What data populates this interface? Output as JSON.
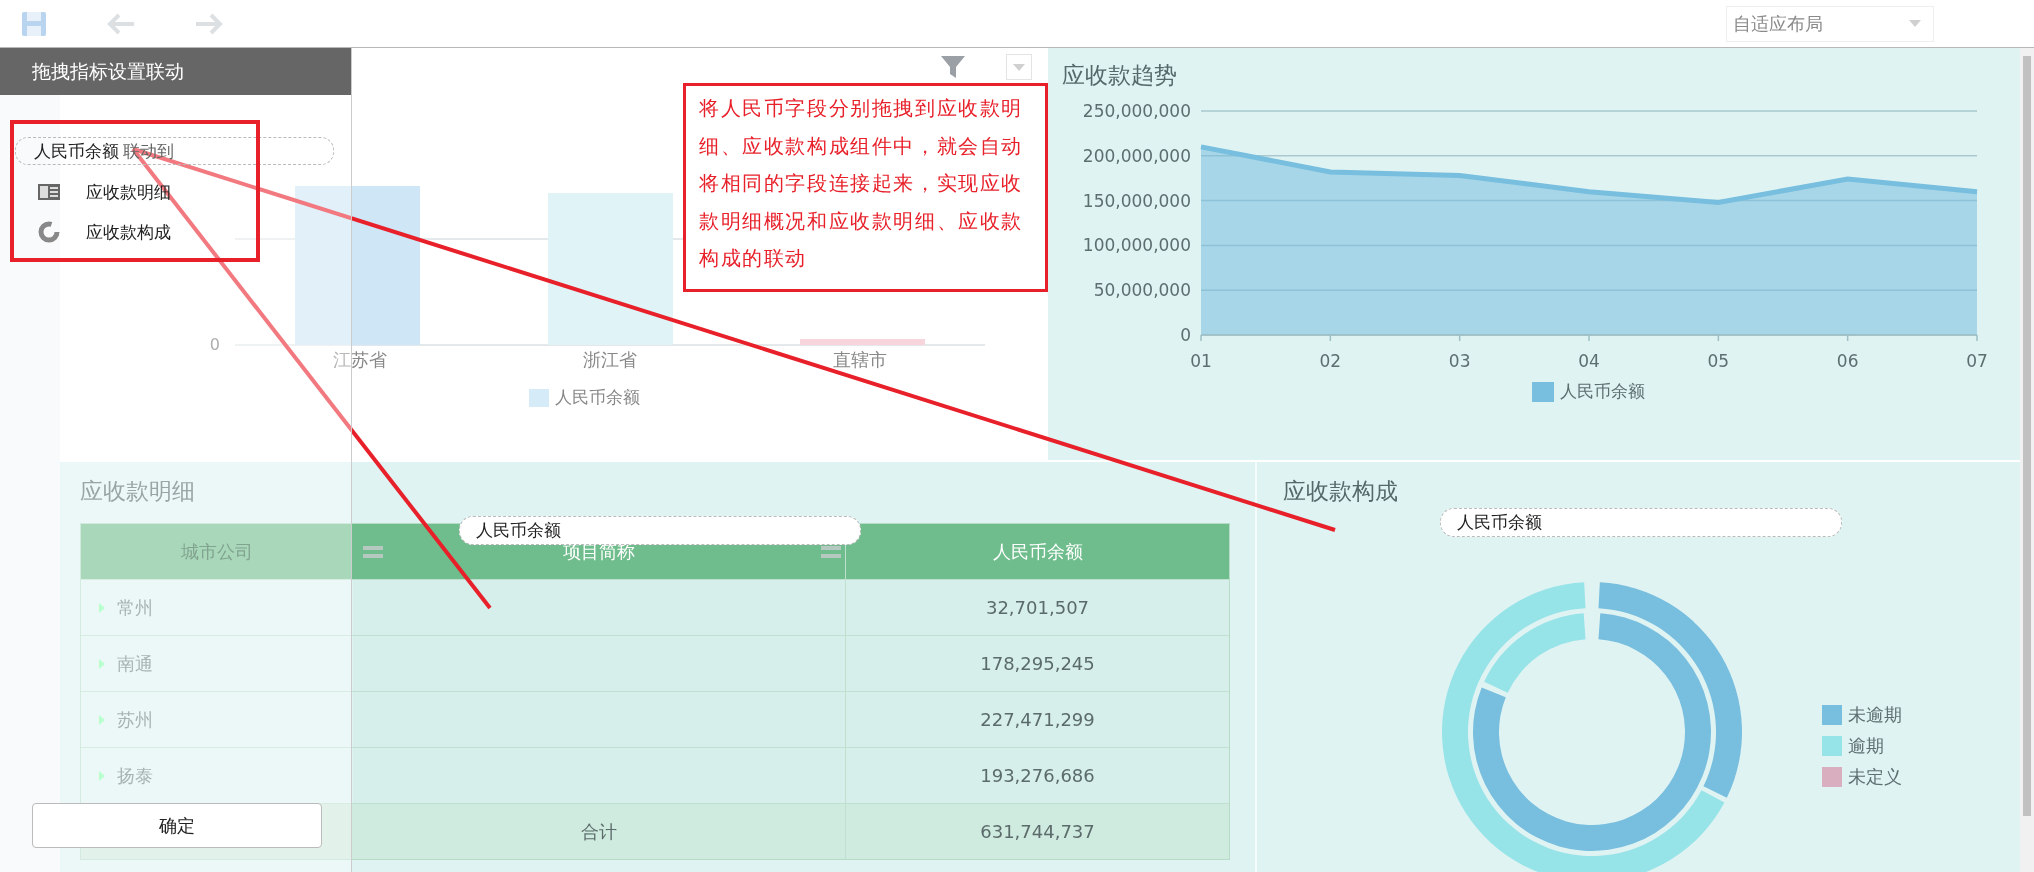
{
  "toolbar": {
    "layout_select": "自适应布局"
  },
  "link_panel": {
    "title": "拖拽指标设置联动",
    "field": "人民币余额",
    "link_label": "联动到",
    "targets": [
      {
        "label": "应收款明细",
        "kind": "table"
      },
      {
        "label": "应收款构成",
        "kind": "donut"
      }
    ],
    "confirm_button": "确定"
  },
  "annotation": {
    "text": "将人民币字段分别拖拽到应收款明细、应收款构成组件中，就会自动将相同的字段连接起来，实现应收款明细概况和应收款明细、应收款构成的联动"
  },
  "bar_widget": {
    "y_tick": "0",
    "categories": [
      "江苏省",
      "浙江省",
      "直辖市"
    ],
    "legend": "人民币余额"
  },
  "trend_widget": {
    "title": "应收款趋势",
    "chart_data": {
      "type": "area",
      "grid": true,
      "categories": [
        "01",
        "02",
        "03",
        "04",
        "05",
        "06",
        "07"
      ],
      "ylim": [
        0,
        250000000
      ],
      "yticks": [
        {
          "value": 0,
          "label": "0"
        },
        {
          "value": 50000000,
          "label": "50,000,000"
        },
        {
          "value": 100000000,
          "label": "100,000,000"
        },
        {
          "value": 150000000,
          "label": "150,000,000"
        },
        {
          "value": 200000000,
          "label": "200,000,000"
        },
        {
          "value": 250000000,
          "label": "250,000,000"
        }
      ],
      "series": [
        {
          "name": "人民币余额",
          "color": "#78bede",
          "values": [
            210000000,
            182000000,
            178000000,
            160000000,
            148000000,
            174000000,
            160000000
          ]
        }
      ]
    }
  },
  "detail_widget": {
    "title": "应收款明细",
    "drop_field": "人民币余额",
    "columns": [
      "城市公司",
      "项目简称",
      "人民币余额"
    ],
    "rows": [
      {
        "city": "常州",
        "amount": "32,701,507"
      },
      {
        "city": "南通",
        "amount": "178,295,245"
      },
      {
        "city": "苏州",
        "amount": "227,471,299"
      },
      {
        "city": "扬泰",
        "amount": "193,276,686"
      }
    ],
    "total": {
      "label": "合计",
      "amount": "631,744,737"
    }
  },
  "composition_widget": {
    "title": "应收款构成",
    "drop_field": "人民币余额",
    "legend": [
      {
        "label": "未逾期",
        "color": "#78bede"
      },
      {
        "label": "逾期",
        "color": "#96e3e8"
      },
      {
        "label": "未定义",
        "color": "#d9aebe"
      }
    ]
  }
}
